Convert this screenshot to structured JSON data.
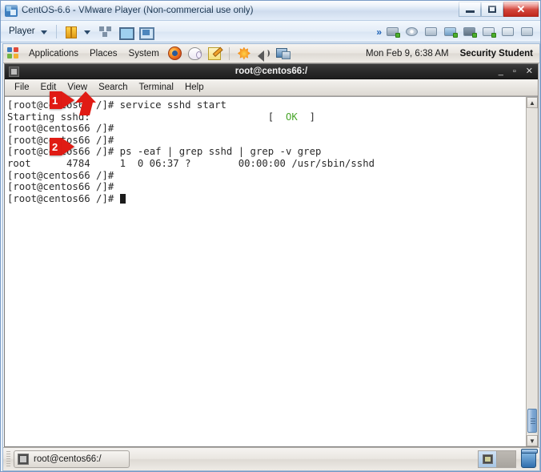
{
  "vmware": {
    "window_title": "CentOS-6.6 - VMware Player (Non-commercial use only)",
    "app_icon": "vmware-icon",
    "window_controls": {
      "minimize": "minimize-icon",
      "maximize": "maximize-icon",
      "close": "✕"
    },
    "toolbar": {
      "player_label": "Player",
      "icons": [
        "pause-icon",
        "snapshot-manager-icon",
        "fullscreen-icon",
        "unity-mode-icon"
      ],
      "chevron": "»",
      "device_icons": [
        "hard-disk-icon",
        "cd-dvd-icon",
        "floppy-icon",
        "network-adapter-icon",
        "printer-icon",
        "sound-card-icon",
        "usb-icon",
        "display-icon"
      ]
    }
  },
  "gnome_top_panel": {
    "menus": [
      "Applications",
      "Places",
      "System"
    ],
    "launchers": [
      "firefox-icon",
      "evolution-mail-icon",
      "text-editor-icon"
    ],
    "tray": [
      "software-update-icon",
      "volume-icon",
      "network-monitor-icon"
    ],
    "clock": "Mon Feb  9,  6:38 AM",
    "user": "Security Student"
  },
  "terminal": {
    "title": "root@centos66:/",
    "titlebar_icon": "terminal-icon",
    "window_buttons": {
      "minimize": "_",
      "maximize": "▫",
      "close": "✕"
    },
    "menubar": [
      "File",
      "Edit",
      "View",
      "Search",
      "Terminal",
      "Help"
    ],
    "lines": [
      {
        "text": "[root@centos66 /]# service sshd start",
        "type": "command"
      },
      {
        "text": "Starting sshd:",
        "type": "output",
        "status_open": "[",
        "status_ok": "OK",
        "status_close": "]"
      },
      {
        "text": "[root@centos66 /]#",
        "type": "prompt"
      },
      {
        "text": "[root@centos66 /]#",
        "type": "prompt"
      },
      {
        "text": "[root@centos66 /]# ps -eaf | grep sshd | grep -v grep",
        "type": "command"
      },
      {
        "text": "root      4784     1  0 06:37 ?        00:00:00 /usr/sbin/sshd",
        "type": "output"
      },
      {
        "text": "[root@centos66 /]#",
        "type": "prompt"
      },
      {
        "text": "[root@centos66 /]#",
        "type": "prompt"
      },
      {
        "text": "[root@centos66 /]#",
        "type": "prompt_cursor"
      }
    ],
    "line1_prompt": "[root@centos66 /]# ",
    "line1_cmd": "service sshd start",
    "line2_text": "Starting sshd:",
    "line2_status_open": "[",
    "line2_status_ok": "OK",
    "line2_status_close": "]",
    "line3_text": "[root@centos66 /]#",
    "line4_text": "[root@centos66 /]#",
    "line5_prompt": "[root@centos66 /]# ",
    "line5_cmd": "ps -eaf | grep sshd | grep -v grep",
    "line6_text": "root      4784     1  0 06:37 ?        00:00:00 /usr/sbin/sshd",
    "line7_text": "[root@centos66 /]#",
    "line8_text": "[root@centos66 /]#",
    "line9_text": "[root@centos66 /]#",
    "scrollbar": {
      "up_arrow": "▲",
      "down_arrow": "▼"
    }
  },
  "gnome_bottom_panel": {
    "task_button": "root@centos66:/",
    "task_icon": "terminal-icon",
    "workspaces": 2,
    "trash": "trash-icon"
  },
  "annotations": [
    {
      "number": "1",
      "target": "service sshd start command prompt"
    },
    {
      "number": "2",
      "target": "ps -eaf grep sshd command prompt"
    },
    {
      "number": "",
      "target": "View menu"
    }
  ],
  "colors": {
    "annotation_red": "#e01b14",
    "terminal_ok_green": "#4aa62c",
    "close_button_red": "#c0271c"
  }
}
